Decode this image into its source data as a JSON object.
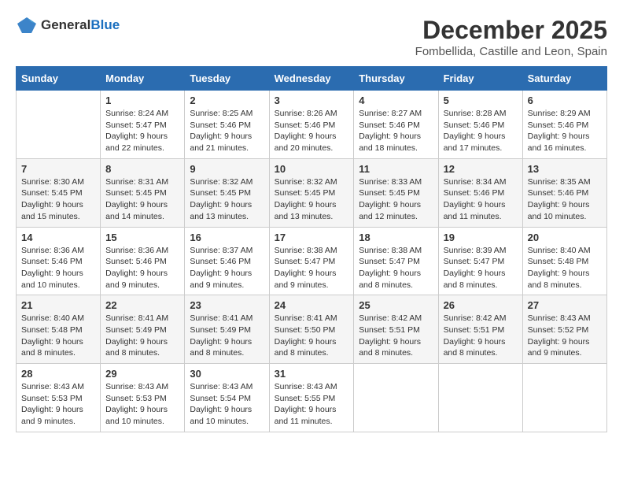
{
  "logo": {
    "general": "General",
    "blue": "Blue"
  },
  "title": "December 2025",
  "subtitle": "Fombellida, Castille and Leon, Spain",
  "days_header": [
    "Sunday",
    "Monday",
    "Tuesday",
    "Wednesday",
    "Thursday",
    "Friday",
    "Saturday"
  ],
  "weeks": [
    [
      {
        "day": "",
        "content": ""
      },
      {
        "day": "1",
        "content": "Sunrise: 8:24 AM\nSunset: 5:47 PM\nDaylight: 9 hours\nand 22 minutes."
      },
      {
        "day": "2",
        "content": "Sunrise: 8:25 AM\nSunset: 5:46 PM\nDaylight: 9 hours\nand 21 minutes."
      },
      {
        "day": "3",
        "content": "Sunrise: 8:26 AM\nSunset: 5:46 PM\nDaylight: 9 hours\nand 20 minutes."
      },
      {
        "day": "4",
        "content": "Sunrise: 8:27 AM\nSunset: 5:46 PM\nDaylight: 9 hours\nand 18 minutes."
      },
      {
        "day": "5",
        "content": "Sunrise: 8:28 AM\nSunset: 5:46 PM\nDaylight: 9 hours\nand 17 minutes."
      },
      {
        "day": "6",
        "content": "Sunrise: 8:29 AM\nSunset: 5:46 PM\nDaylight: 9 hours\nand 16 minutes."
      }
    ],
    [
      {
        "day": "7",
        "content": "Sunrise: 8:30 AM\nSunset: 5:45 PM\nDaylight: 9 hours\nand 15 minutes."
      },
      {
        "day": "8",
        "content": "Sunrise: 8:31 AM\nSunset: 5:45 PM\nDaylight: 9 hours\nand 14 minutes."
      },
      {
        "day": "9",
        "content": "Sunrise: 8:32 AM\nSunset: 5:45 PM\nDaylight: 9 hours\nand 13 minutes."
      },
      {
        "day": "10",
        "content": "Sunrise: 8:32 AM\nSunset: 5:45 PM\nDaylight: 9 hours\nand 13 minutes."
      },
      {
        "day": "11",
        "content": "Sunrise: 8:33 AM\nSunset: 5:45 PM\nDaylight: 9 hours\nand 12 minutes."
      },
      {
        "day": "12",
        "content": "Sunrise: 8:34 AM\nSunset: 5:46 PM\nDaylight: 9 hours\nand 11 minutes."
      },
      {
        "day": "13",
        "content": "Sunrise: 8:35 AM\nSunset: 5:46 PM\nDaylight: 9 hours\nand 10 minutes."
      }
    ],
    [
      {
        "day": "14",
        "content": "Sunrise: 8:36 AM\nSunset: 5:46 PM\nDaylight: 9 hours\nand 10 minutes."
      },
      {
        "day": "15",
        "content": "Sunrise: 8:36 AM\nSunset: 5:46 PM\nDaylight: 9 hours\nand 9 minutes."
      },
      {
        "day": "16",
        "content": "Sunrise: 8:37 AM\nSunset: 5:46 PM\nDaylight: 9 hours\nand 9 minutes."
      },
      {
        "day": "17",
        "content": "Sunrise: 8:38 AM\nSunset: 5:47 PM\nDaylight: 9 hours\nand 9 minutes."
      },
      {
        "day": "18",
        "content": "Sunrise: 8:38 AM\nSunset: 5:47 PM\nDaylight: 9 hours\nand 8 minutes."
      },
      {
        "day": "19",
        "content": "Sunrise: 8:39 AM\nSunset: 5:47 PM\nDaylight: 9 hours\nand 8 minutes."
      },
      {
        "day": "20",
        "content": "Sunrise: 8:40 AM\nSunset: 5:48 PM\nDaylight: 9 hours\nand 8 minutes."
      }
    ],
    [
      {
        "day": "21",
        "content": "Sunrise: 8:40 AM\nSunset: 5:48 PM\nDaylight: 9 hours\nand 8 minutes."
      },
      {
        "day": "22",
        "content": "Sunrise: 8:41 AM\nSunset: 5:49 PM\nDaylight: 9 hours\nand 8 minutes."
      },
      {
        "day": "23",
        "content": "Sunrise: 8:41 AM\nSunset: 5:49 PM\nDaylight: 9 hours\nand 8 minutes."
      },
      {
        "day": "24",
        "content": "Sunrise: 8:41 AM\nSunset: 5:50 PM\nDaylight: 9 hours\nand 8 minutes."
      },
      {
        "day": "25",
        "content": "Sunrise: 8:42 AM\nSunset: 5:51 PM\nDaylight: 9 hours\nand 8 minutes."
      },
      {
        "day": "26",
        "content": "Sunrise: 8:42 AM\nSunset: 5:51 PM\nDaylight: 9 hours\nand 8 minutes."
      },
      {
        "day": "27",
        "content": "Sunrise: 8:43 AM\nSunset: 5:52 PM\nDaylight: 9 hours\nand 9 minutes."
      }
    ],
    [
      {
        "day": "28",
        "content": "Sunrise: 8:43 AM\nSunset: 5:53 PM\nDaylight: 9 hours\nand 9 minutes."
      },
      {
        "day": "29",
        "content": "Sunrise: 8:43 AM\nSunset: 5:53 PM\nDaylight: 9 hours\nand 10 minutes."
      },
      {
        "day": "30",
        "content": "Sunrise: 8:43 AM\nSunset: 5:54 PM\nDaylight: 9 hours\nand 10 minutes."
      },
      {
        "day": "31",
        "content": "Sunrise: 8:43 AM\nSunset: 5:55 PM\nDaylight: 9 hours\nand 11 minutes."
      },
      {
        "day": "",
        "content": ""
      },
      {
        "day": "",
        "content": ""
      },
      {
        "day": "",
        "content": ""
      }
    ]
  ]
}
